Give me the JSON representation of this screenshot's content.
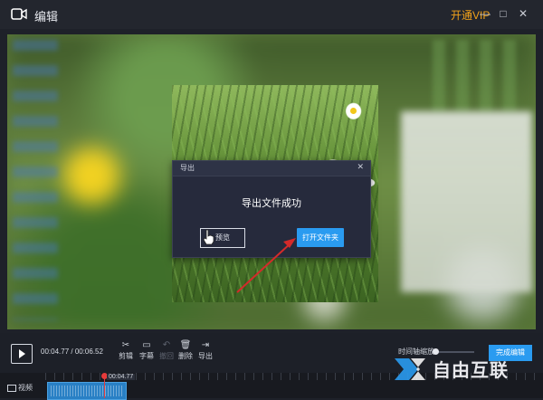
{
  "window": {
    "title": "编辑",
    "vip_label": "开通VIP",
    "min_glyph": "—",
    "restore_glyph": "□",
    "close_glyph": "✕"
  },
  "dialog": {
    "title": "导出",
    "close_glyph": "✕",
    "message": "导出文件成功",
    "preview_button": "预览",
    "open_folder_button": "打开文件夹"
  },
  "controls": {
    "current_time": "00:04.77",
    "separator": " / ",
    "total_time": "00:06.52",
    "tools": [
      {
        "label": "剪辑",
        "icon": "scissors-icon",
        "glyph": "✂",
        "enabled": true
      },
      {
        "label": "字幕",
        "icon": "subtitle-icon",
        "glyph": "▭",
        "enabled": true
      },
      {
        "label": "撤回",
        "icon": "undo-icon",
        "glyph": "↶",
        "enabled": false
      },
      {
        "label": "删除",
        "icon": "trash-icon",
        "glyph": "🗑",
        "enabled": true
      },
      {
        "label": "导出",
        "icon": "export-icon",
        "glyph": "⇥",
        "enabled": true
      }
    ],
    "speed_label": "时间轴缩放",
    "finish_button": "完成编辑"
  },
  "timeline": {
    "track_label": "视频",
    "playhead_time": "00:04.77"
  },
  "watermark": {
    "text": "自由互联"
  },
  "colors": {
    "accent": "#2a9bf0",
    "vip": "#f2a21a",
    "playhead": "#e63b3b",
    "arrow": "#d42a2a"
  }
}
